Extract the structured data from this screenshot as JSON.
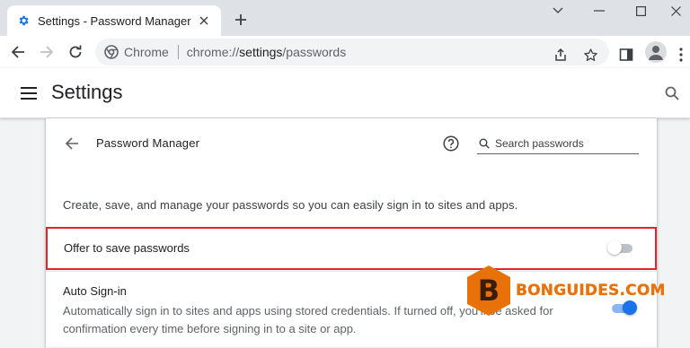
{
  "tab": {
    "title": "Settings - Password Manager"
  },
  "toolbar": {
    "site_label": "Chrome",
    "url_scheme": "chrome://",
    "url_host": "settings",
    "url_path": "/passwords"
  },
  "header": {
    "title": "Settings"
  },
  "password_manager": {
    "title": "Password Manager",
    "search_placeholder": "Search passwords",
    "description": "Create, save, and manage your passwords so you can easily sign in to sites and apps.",
    "offer_to_save": {
      "label": "Offer to save passwords",
      "enabled": false
    },
    "auto_signin": {
      "title": "Auto Sign-in",
      "description": "Automatically sign in to sites and apps using stored credentials. If turned off, you'll be asked for confirmation every time before signing in to a site or app.",
      "enabled": true
    }
  },
  "watermark": {
    "letter": "B",
    "text": "BONGUIDES.COM"
  },
  "colors": {
    "accent": "#1a73e8",
    "highlight_border": "#e3252b",
    "watermark": "#e8710a"
  },
  "icons": [
    "settings-gear-icon",
    "close-icon",
    "plus-icon",
    "minimize-icon",
    "maximize-icon",
    "chevron-down-icon",
    "back-arrow-icon",
    "forward-arrow-icon",
    "reload-icon",
    "chrome-icon",
    "share-icon",
    "star-icon",
    "side-panel-icon",
    "profile-icon",
    "more-vert-icon",
    "hamburger-icon",
    "search-icon",
    "help-icon"
  ]
}
